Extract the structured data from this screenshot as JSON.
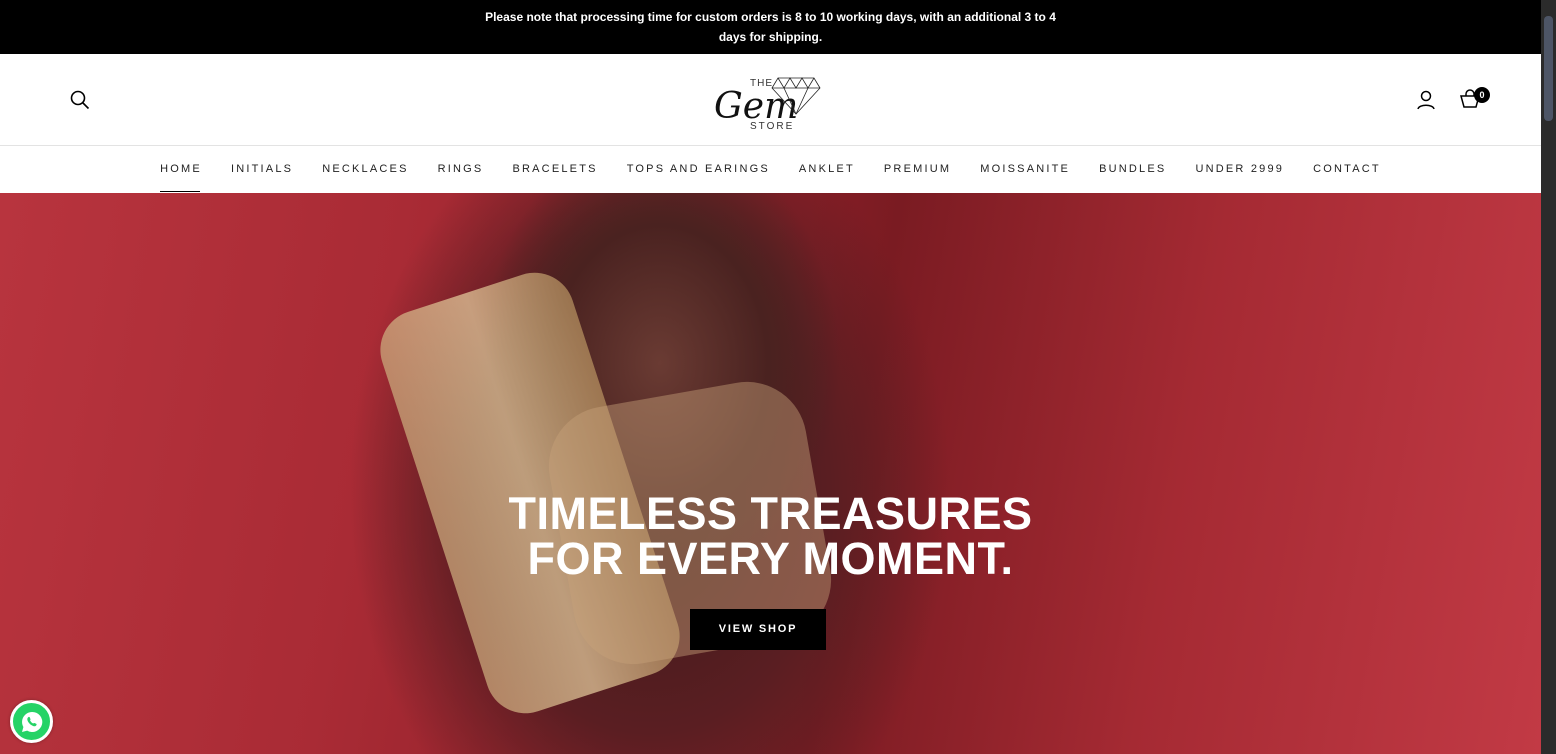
{
  "announcement": "Please note that processing time for custom orders is 8 to 10 working days, with an additional 3 to 4 days for shipping.",
  "logo": {
    "script": "Gem",
    "top": "THE",
    "bottom": "STORE"
  },
  "cart": {
    "count": "0"
  },
  "nav": [
    {
      "label": "HOME",
      "active": true
    },
    {
      "label": "INITIALS"
    },
    {
      "label": "NECKLACES"
    },
    {
      "label": "RINGS"
    },
    {
      "label": "BRACELETS"
    },
    {
      "label": "TOPS AND EARINGS"
    },
    {
      "label": "ANKLET"
    },
    {
      "label": "PREMIUM"
    },
    {
      "label": "MOISSANITE"
    },
    {
      "label": "BUNDLES"
    },
    {
      "label": "UNDER 2999"
    },
    {
      "label": "CONTACT"
    }
  ],
  "hero": {
    "line1": "TIMELESS TREASURES",
    "line2": "FOR EVERY MOMENT.",
    "cta": "VIEW SHOP"
  }
}
